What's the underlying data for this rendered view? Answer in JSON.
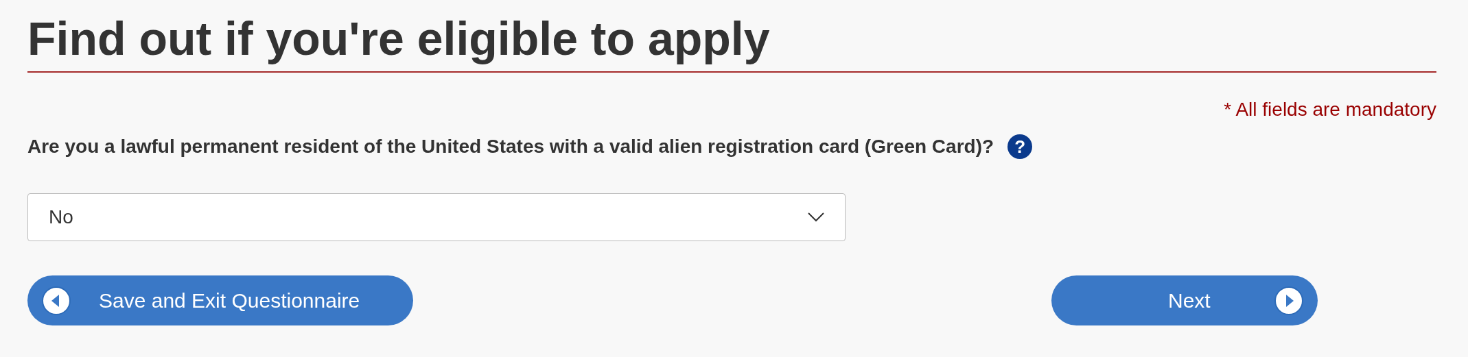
{
  "heading": "Find out if you're eligible to apply",
  "mandatory_note": "* All fields are mandatory",
  "question": {
    "label": "Are you a lawful permanent resident of the United States with a valid alien registration card (Green Card)?",
    "help_icon": "?"
  },
  "select": {
    "value": "No"
  },
  "buttons": [
    {
      "label": "Save and Exit Questionnaire",
      "kind": "back"
    },
    {
      "label": "Next",
      "kind": "next"
    }
  ]
}
